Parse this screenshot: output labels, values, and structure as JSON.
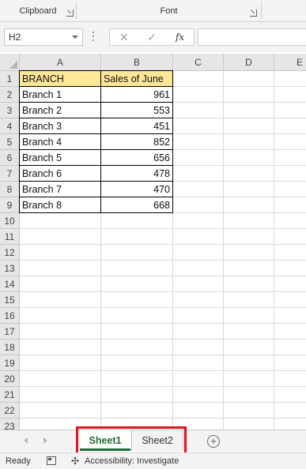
{
  "ribbon": {
    "groups": [
      {
        "label": "Clipboard"
      },
      {
        "label": "Font"
      }
    ]
  },
  "formula_bar": {
    "name_box": "H2",
    "cancel_icon": "✕",
    "enter_icon": "✓",
    "fx_label": "fx",
    "formula": ""
  },
  "columns": [
    "A",
    "B",
    "C",
    "D",
    "E"
  ],
  "rows": [
    "1",
    "2",
    "3",
    "4",
    "5",
    "6",
    "7",
    "8",
    "9",
    "10",
    "11",
    "12",
    "13",
    "14",
    "15",
    "16",
    "17",
    "18",
    "19",
    "20",
    "21",
    "22",
    "23"
  ],
  "table": {
    "headers": [
      "BRANCH",
      "Sales of June"
    ],
    "records": [
      {
        "branch": "Branch 1",
        "sales": "961"
      },
      {
        "branch": "Branch 2",
        "sales": "553"
      },
      {
        "branch": "Branch 3",
        "sales": "451"
      },
      {
        "branch": "Branch 4",
        "sales": "852"
      },
      {
        "branch": "Branch 5",
        "sales": "656"
      },
      {
        "branch": "Branch 6",
        "sales": "478"
      },
      {
        "branch": "Branch 7",
        "sales": "470"
      },
      {
        "branch": "Branch 8",
        "sales": "668"
      }
    ],
    "header_fill": "#ffe699"
  },
  "sheets": {
    "tabs": [
      {
        "label": "Sheet1",
        "active": true
      },
      {
        "label": "Sheet2",
        "active": false
      }
    ],
    "add_icon": "+",
    "active_color": "#1e6b34",
    "highlight_color": "#e0141e"
  },
  "status": {
    "ready": "Ready",
    "accessibility": "Accessibility: Investigate"
  }
}
